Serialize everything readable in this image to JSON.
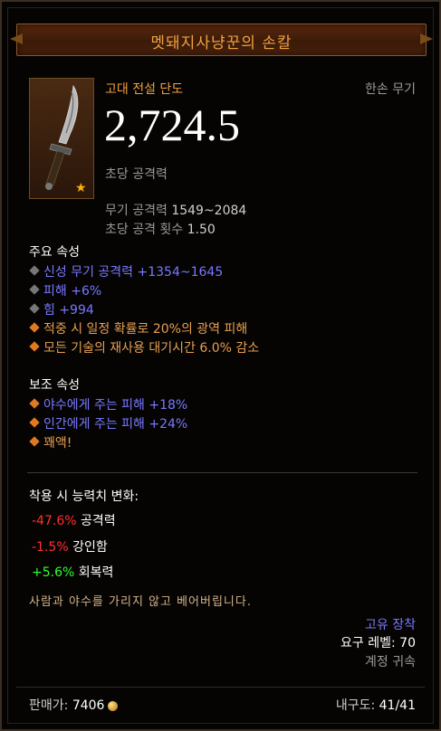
{
  "item": {
    "name": "멧돼지사냥꾼의 손칼",
    "type": "고대 전설 단도",
    "slot": "한손 무기",
    "dps": "2,724.5",
    "dps_label": "초당 공격력",
    "damage_label": "무기 공격력",
    "damage_value": "1549~2084",
    "aps_label": "초당 공격 횟수",
    "aps_value": "1.50",
    "ancient_star": "★"
  },
  "primary": {
    "heading": "주요 속성",
    "affixes": [
      {
        "text": "신성 무기 공격력 +1354~1645",
        "color": "blue",
        "bullet": "gray"
      },
      {
        "text": "피해 +6%",
        "color": "blue",
        "bullet": "gray"
      },
      {
        "text": "힘 +994",
        "color": "blue",
        "bullet": "gray"
      },
      {
        "text": "적중 시 일정 확률로 20%의 광역 피해",
        "color": "orange",
        "bullet": "orange"
      },
      {
        "text": "모든 기술의 재사용 대기시간 6.0% 감소",
        "color": "orange",
        "bullet": "orange"
      }
    ]
  },
  "secondary": {
    "heading": "보조 속성",
    "affixes": [
      {
        "text": "야수에게 주는 피해 +18%",
        "color": "blue",
        "bullet": "orange"
      },
      {
        "text": "인간에게 주는 피해 +24%",
        "color": "blue",
        "bullet": "orange"
      },
      {
        "text": "꽤액!",
        "color": "orange",
        "bullet": "orange"
      }
    ]
  },
  "changes": {
    "heading": "착용 시 능력치 변화:",
    "rows": [
      {
        "value": "-47.6%",
        "label": "공격력",
        "sign": "neg"
      },
      {
        "value": "-1.5%",
        "label": "강인함",
        "sign": "neg"
      },
      {
        "value": "+5.6%",
        "label": "회복력",
        "sign": "pos"
      }
    ]
  },
  "flavor": "사람과 야수를 가리지 않고 베어버립니다.",
  "unique_equipped": "고유 장착",
  "required_level": "요구 레벨: 70",
  "account_bound": "계정 귀속",
  "footer": {
    "sell_label": "판매가:",
    "sell_value": "7406",
    "durability_label": "내구도:",
    "durability_value": "41/41"
  },
  "colors": {
    "legendary_orange": "#f0a040",
    "magic_blue": "#7878ff",
    "negative_red": "#ff3030",
    "positive_green": "#30ff30"
  }
}
